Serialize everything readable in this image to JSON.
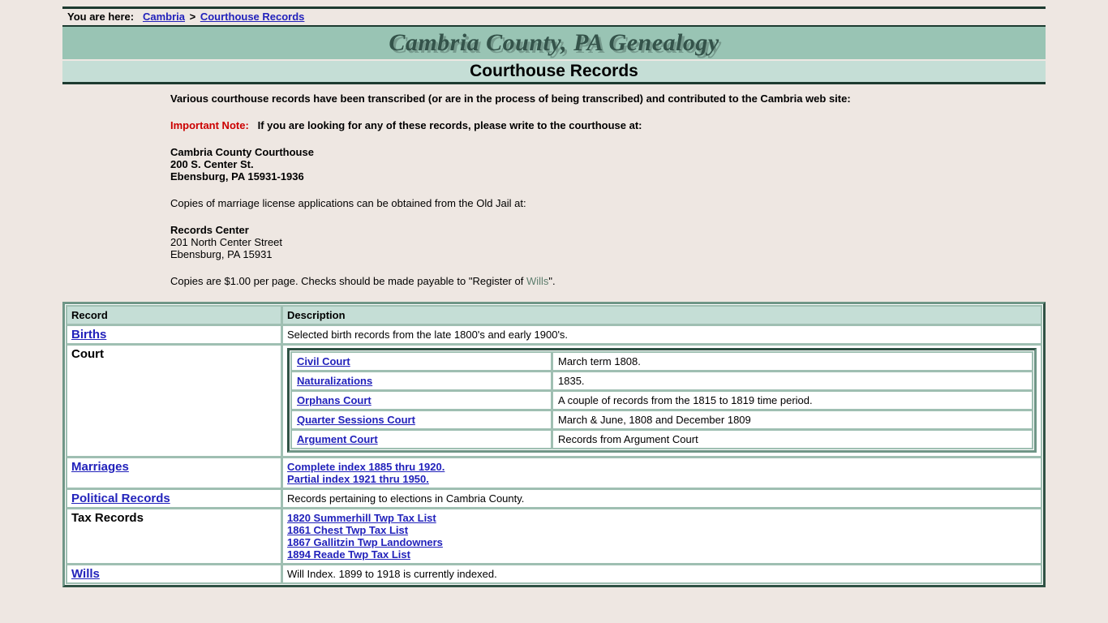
{
  "breadcrumb": {
    "label": "You are here:",
    "items": [
      {
        "text": "Cambria",
        "type": "link"
      },
      {
        "text": "Courthouse Records",
        "type": "link"
      }
    ],
    "separator": ">"
  },
  "banner": {
    "site_title": "Cambria County, PA Genealogy",
    "page_title": "Courthouse Records",
    "banner_color": "#99c4b4",
    "subbanner_color": "#c5ded6",
    "title_color": "#34534a"
  },
  "intro": {
    "paragraph1": "Various courthouse records have been transcribed (or are in the process of being transcribed) and contributed to the Cambria web site:",
    "note_label": "Important Note:",
    "note_color": "#cc0000",
    "note_text": "If you are looking for any of these records, please write to the courthouse at:",
    "courthouse_address": [
      "Cambria County Courthouse",
      "200 S. Center St.",
      "Ebensburg, PA 15931-1936"
    ],
    "marriage_line": "Copies of marriage license applications can be obtained from the Old Jail at:",
    "records_center_name": "Records Center",
    "records_center_address": [
      "201 North Center Street",
      "Ebensburg, PA 15931"
    ],
    "copies_line_pre": "Copies are $1.00 per page. Checks should be made payable to \"Register of ",
    "copies_line_wills": "Wills",
    "copies_line_post": "\"."
  },
  "table": {
    "headers": {
      "record": "Record",
      "description": "Description"
    },
    "rows": [
      {
        "record": "Births",
        "record_is_link": true,
        "description": "Selected birth records from the late 1800's and early 1900's."
      },
      {
        "record": "Court",
        "record_is_link": false,
        "nested": [
          {
            "name": "Civil Court",
            "description": "March term 1808."
          },
          {
            "name": "Naturalizations",
            "description": "1835."
          },
          {
            "name": "Orphans Court",
            "description": "A couple of records from the 1815 to 1819 time period."
          },
          {
            "name": "Quarter Sessions Court",
            "description": "March & June, 1808 and December 1809"
          },
          {
            "name": "Argument Court",
            "description": "Records from Argument Court"
          }
        ]
      },
      {
        "record": "Marriages",
        "record_is_link": true,
        "description_links": [
          "Complete index 1885 thru 1920.",
          "Partial index 1921 thru 1950."
        ]
      },
      {
        "record": "Political Records",
        "record_is_link": true,
        "description": "Records pertaining to elections in Cambria County."
      },
      {
        "record": "Tax Records",
        "record_is_link": false,
        "description_links": [
          "1820 Summerhill Twp Tax List",
          "1861 Chest Twp Tax List",
          "1867 Gallitzin Twp Landowners",
          "1894 Reade Twp Tax List"
        ]
      },
      {
        "record": "Wills",
        "record_is_link": true,
        "description": "Will Index. 1899 to 1918 is currently indexed."
      }
    ]
  }
}
